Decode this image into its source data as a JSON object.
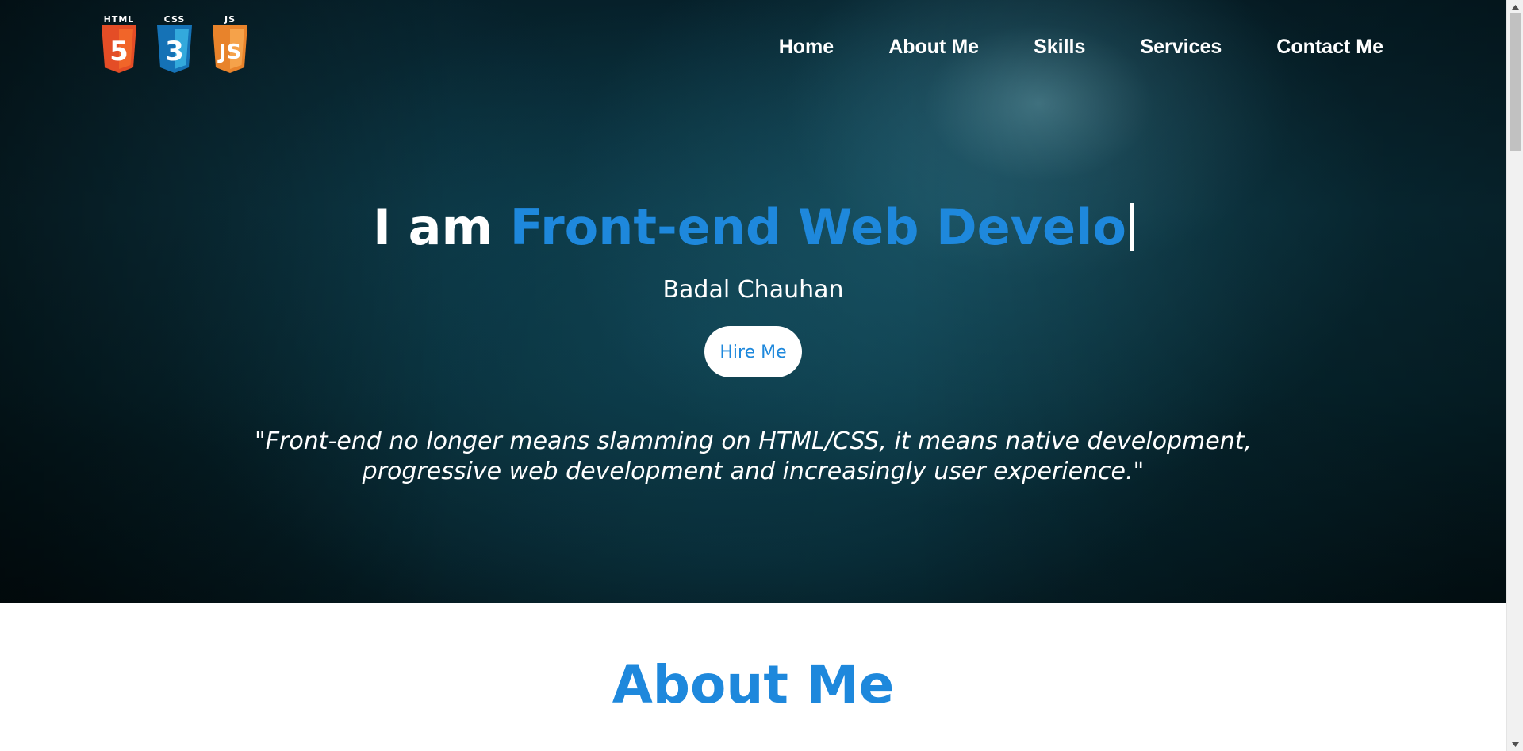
{
  "logos": [
    {
      "label": "HTML",
      "number": "5",
      "color": "#e44d26",
      "icon": "html5-icon"
    },
    {
      "label": "CSS",
      "number": "3",
      "color": "#1572b6",
      "icon": "css3-icon"
    },
    {
      "label": "JS",
      "number": "JS",
      "color": "#f0772b",
      "icon": "js-icon"
    }
  ],
  "nav": {
    "items": [
      "Home",
      "About Me",
      "Skills",
      "Services",
      "Contact Me"
    ]
  },
  "hero": {
    "prefix": "I am ",
    "role": "Front-end Web Develo",
    "name": "Badal Chauhan",
    "cta_label": "Hire Me",
    "quote_line1": "\"Front-end no longer means slamming on HTML/CSS, it means native development,",
    "quote_line2": "progressive web development and increasingly user experience.\""
  },
  "about": {
    "title": "About Me"
  },
  "colors": {
    "accent": "#1e88dc",
    "text_light": "#ffffff",
    "hero_dark": "#06212b"
  }
}
